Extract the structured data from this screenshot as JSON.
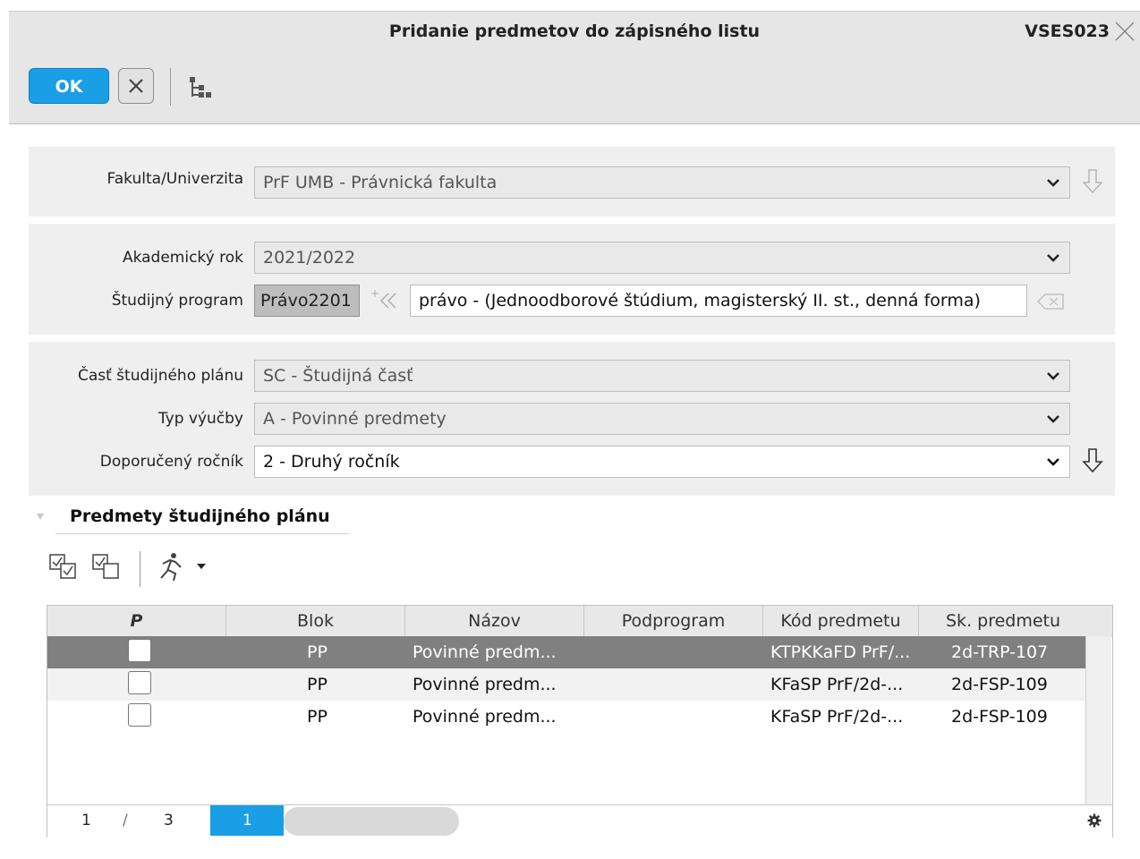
{
  "window": {
    "title": "Pridanie predmetov do zápisného listu",
    "code": "VSES023"
  },
  "toolbar": {
    "ok_label": "OK"
  },
  "form": {
    "faculty": {
      "label": "Fakulta/Univerzita",
      "value": "PrF UMB - Právnická fakulta"
    },
    "academic_year": {
      "label": "Akademický rok",
      "value": "2021/2022"
    },
    "study_program": {
      "label": "Študijný program",
      "code": "Právo2201",
      "name": "právo - (Jednoodborové štúdium, magisterský II. st., denná forma)"
    },
    "plan_part": {
      "label": "Časť študijného plánu",
      "value": "SC - Študijná časť"
    },
    "teaching_type": {
      "label": "Typ výučby",
      "value": "A - Povinné predmety"
    },
    "recommended_year": {
      "label": "Doporučený ročník",
      "value": "2 - Druhý ročník"
    }
  },
  "section": {
    "title": "Predmety študijného plánu"
  },
  "table": {
    "columns": [
      "P",
      "Blok",
      "Názov",
      "Podprogram",
      "Kód predmetu",
      "Sk. predmetu"
    ],
    "rows": [
      {
        "blok": "PP",
        "nazov": "Povinné predm...",
        "podprogram": "",
        "kod": "KTPKKaFD PrF/...",
        "sk": "2d-TRP-107",
        "selected": true
      },
      {
        "blok": "PP",
        "nazov": "Povinné predm...",
        "podprogram": "",
        "kod": "KFaSP PrF/2d-...",
        "sk": "2d-FSP-109",
        "selected": false
      },
      {
        "blok": "PP",
        "nazov": "Povinné predm...",
        "podprogram": "",
        "kod": "KFaSP PrF/2d-...",
        "sk": "2d-FSP-109",
        "selected": false
      }
    ],
    "pager": {
      "current": "1",
      "separator": "/",
      "total": "3",
      "page_button": "1"
    }
  },
  "colors": {
    "accent": "#1a9ee6",
    "selected_row": "#808080",
    "panel": "#efefef"
  }
}
